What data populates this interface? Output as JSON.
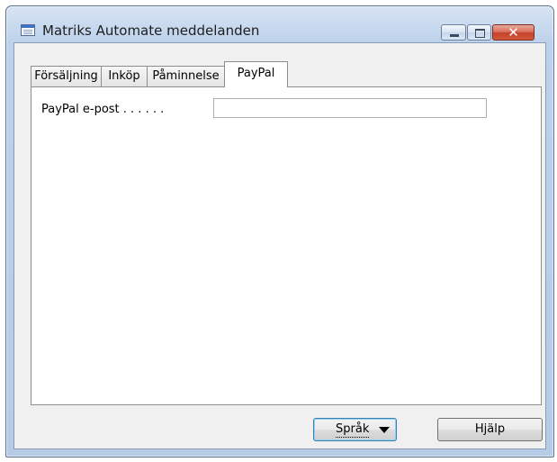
{
  "window": {
    "title": "Matriks Automate meddelanden",
    "app_icon": "form-icon",
    "controls": {
      "minimize_icon": "minimize-icon",
      "maximize_icon": "maximize-icon",
      "close_glyph": "✕"
    }
  },
  "tabs": [
    {
      "label": "Försäljning",
      "active": false
    },
    {
      "label": "Inköp",
      "active": false
    },
    {
      "label": "Påminnelse",
      "active": false
    },
    {
      "label": "PayPal",
      "active": true
    }
  ],
  "form": {
    "paypal_email_label": "PayPal e-post . . . . . .",
    "paypal_email_value": "",
    "paypal_email_placeholder": ""
  },
  "buttons": {
    "language_label": "Språk",
    "language_caret_icon": "dropdown-arrow-icon",
    "help_label": "Hjälp"
  },
  "colors": {
    "title_bar": "#c3d6ed",
    "client_bg": "#f0f0f0",
    "close_button": "#c4412a",
    "focus_border": "#3c7fb1"
  }
}
